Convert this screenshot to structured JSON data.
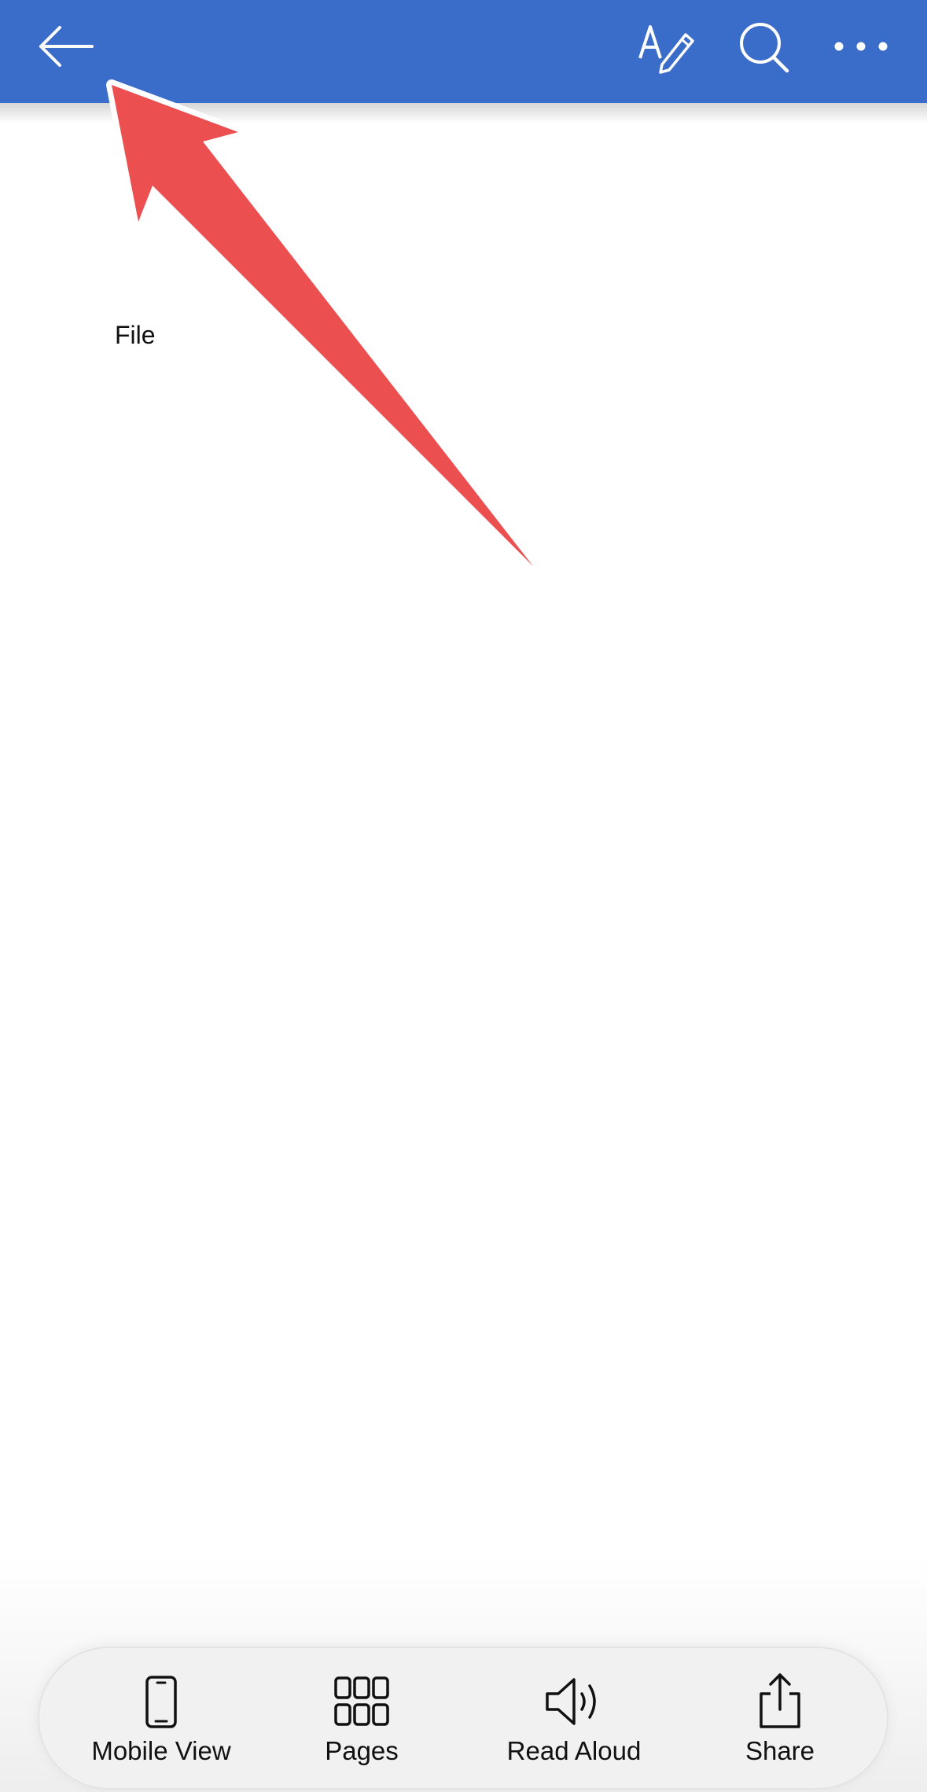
{
  "header": {
    "back_icon": "arrow-left-icon",
    "edit_icon": "text-edit-icon",
    "search_icon": "search-icon",
    "more_icon": "more-horizontal-icon",
    "background_color": "#3a6cc9"
  },
  "document": {
    "text": "File"
  },
  "annotation": {
    "icon": "red-arrow-annotation",
    "color": "#eb4f4f"
  },
  "bottom_toolbar": {
    "items": [
      {
        "label": "Mobile View",
        "icon": "mobile-phone-icon"
      },
      {
        "label": "Pages",
        "icon": "pages-grid-icon"
      },
      {
        "label": "Read Aloud",
        "icon": "speaker-icon"
      },
      {
        "label": "Share",
        "icon": "share-icon"
      }
    ]
  }
}
